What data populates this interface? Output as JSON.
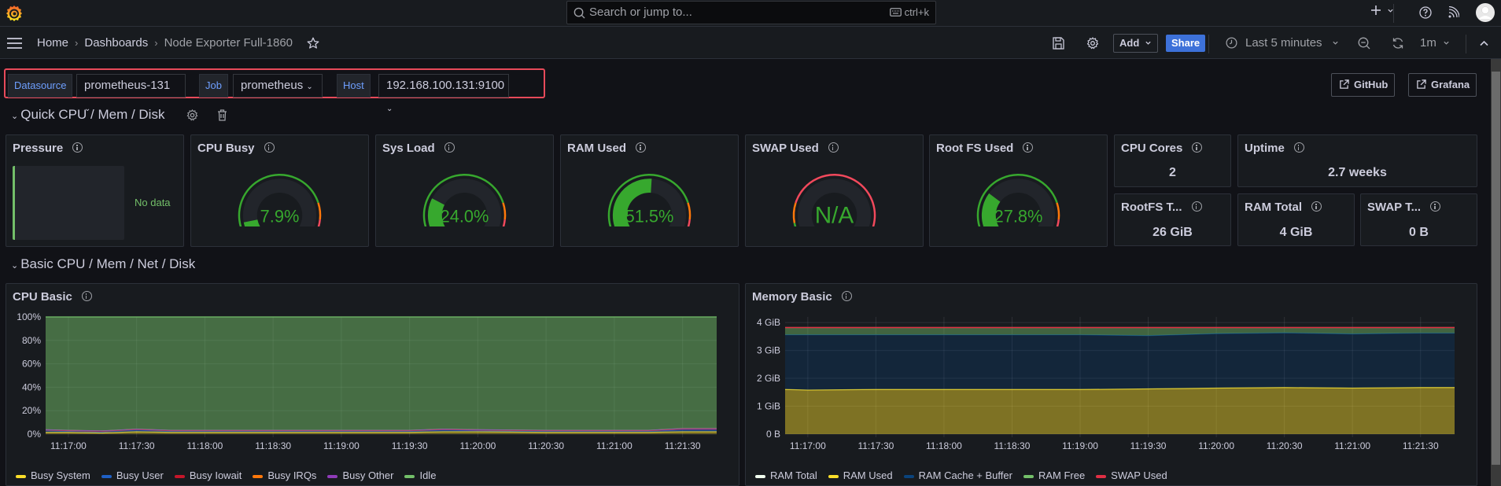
{
  "topbar": {
    "search_placeholder": "Search or jump to...",
    "search_shortcut": "ctrl+k",
    "icons": [
      "grafana-logo-icon",
      "search-icon",
      "keyboard-icon",
      "plus-icon",
      "help-icon",
      "rss-icon",
      "avatar-icon"
    ]
  },
  "navbar": {
    "breadcrumbs": [
      "Home",
      "Dashboards",
      "Node Exporter Full-1860"
    ],
    "add_label": "Add",
    "share_label": "Share",
    "time_range": "Last 5 minutes",
    "refresh_interval": "1m"
  },
  "variables": [
    {
      "label": "Datasource",
      "value": "prometheus-131"
    },
    {
      "label": "Job",
      "value": "prometheus"
    },
    {
      "label": "Host",
      "value": "192.168.100.131:9100"
    }
  ],
  "links": [
    "GitHub",
    "Grafana"
  ],
  "rows": [
    {
      "title": "Quick CPU / Mem / Disk"
    },
    {
      "title": "Basic CPU / Mem / Net / Disk"
    }
  ],
  "panels": {
    "pressure": {
      "title": "Pressure",
      "value": "No data"
    },
    "cpu_busy": {
      "title": "CPU Busy",
      "value": "7.9%",
      "percent": 7.9
    },
    "sys_load": {
      "title": "Sys Load",
      "value": "24.0%",
      "percent": 24.0
    },
    "ram_used": {
      "title": "RAM Used",
      "value": "51.5%",
      "percent": 51.5
    },
    "swap_used": {
      "title": "SWAP Used",
      "value": "N/A",
      "percent": null
    },
    "root_fs_used": {
      "title": "Root FS Used",
      "value": "27.8%",
      "percent": 27.8
    },
    "cpu_cores": {
      "title": "CPU Cores",
      "value": "2"
    },
    "uptime": {
      "title": "Uptime",
      "value": "2.7 weeks"
    },
    "rootfs_total": {
      "title": "RootFS T...",
      "value": "26 GiB"
    },
    "ram_total": {
      "title": "RAM Total",
      "value": "4 GiB"
    },
    "swap_total": {
      "title": "SWAP T...",
      "value": "0 B"
    }
  },
  "colors": {
    "green": "#37a82e",
    "orange": "#ff780a",
    "red": "#f2495c",
    "accent": "#3d71d9"
  },
  "chart_data": [
    {
      "type": "area",
      "title": "CPU Basic",
      "ylim": [
        0,
        100
      ],
      "yticks": [
        "0%",
        "20%",
        "40%",
        "60%",
        "80%",
        "100%"
      ],
      "x": [
        "11:16:50",
        "11:17:00",
        "11:17:15",
        "11:17:30",
        "11:17:45",
        "11:18:00",
        "11:18:30",
        "11:19:00",
        "11:19:30",
        "11:19:45",
        "11:20:00",
        "11:20:30",
        "11:21:00",
        "11:21:15",
        "11:21:30",
        "11:21:45"
      ],
      "xticks": [
        "11:17:00",
        "11:17:30",
        "11:18:00",
        "11:18:30",
        "11:19:00",
        "11:19:30",
        "11:20:00",
        "11:20:30",
        "11:21:00",
        "11:21:30"
      ],
      "stacked": true,
      "series": [
        {
          "name": "Busy System",
          "color": "#fade2a",
          "values": [
            1.5,
            1.5,
            1,
            2,
            1.5,
            1.5,
            1.5,
            1.5,
            1.5,
            2,
            2,
            1.5,
            1.5,
            1.5,
            2,
            2
          ]
        },
        {
          "name": "Busy User",
          "color": "#1f60c4",
          "values": [
            1.5,
            1,
            1,
            1.5,
            1,
            1,
            1,
            1,
            1,
            1.5,
            1,
            1,
            1,
            1,
            1.5,
            1.5
          ]
        },
        {
          "name": "Busy Iowait",
          "color": "#c4162a",
          "values": [
            0.5,
            0.5,
            0.5,
            0.5,
            0.5,
            0.5,
            0.5,
            0.5,
            0.5,
            0.5,
            0.5,
            0.5,
            0.5,
            0.5,
            1,
            1
          ]
        },
        {
          "name": "Busy IRQs",
          "color": "#ff780a",
          "values": [
            0.2,
            0.2,
            0.2,
            0.2,
            0.2,
            0.2,
            0.2,
            0.2,
            0.2,
            0.2,
            0.2,
            0.2,
            0.2,
            0.2,
            0.2,
            0.2
          ]
        },
        {
          "name": "Busy Other",
          "color": "#8f3bb8",
          "values": [
            0.1,
            0.1,
            0.1,
            0.1,
            0.1,
            0.1,
            0.1,
            0.1,
            0.1,
            0.1,
            0.1,
            0.1,
            0.1,
            0.1,
            0.1,
            0.1
          ]
        },
        {
          "name": "Idle",
          "color": "#73bf69",
          "values": [
            96.2,
            96.7,
            97.2,
            95.7,
            96.7,
            96.7,
            96.7,
            96.7,
            96.7,
            95.7,
            96.2,
            96.7,
            96.7,
            96.7,
            95.2,
            95.2
          ]
        }
      ],
      "legend": "bottom"
    },
    {
      "type": "area",
      "title": "Memory Basic",
      "ylim": [
        0,
        4.2
      ],
      "yticks": [
        "0 B",
        "1 GiB",
        "2 GiB",
        "3 GiB",
        "4 GiB"
      ],
      "x": [
        "11:16:50",
        "11:17:00",
        "11:17:30",
        "11:18:00",
        "11:18:30",
        "11:19:00",
        "11:19:30",
        "11:20:00",
        "11:20:30",
        "11:21:00",
        "11:21:30",
        "11:21:45"
      ],
      "xticks": [
        "11:17:00",
        "11:17:30",
        "11:18:00",
        "11:18:30",
        "11:19:00",
        "11:19:30",
        "11:20:00",
        "11:20:30",
        "11:21:00",
        "11:21:30"
      ],
      "series": [
        {
          "name": "RAM Total",
          "color": "#f0fdee",
          "values": [
            3.82,
            3.82,
            3.82,
            3.82,
            3.82,
            3.82,
            3.82,
            3.82,
            3.82,
            3.82,
            3.82,
            3.82
          ]
        },
        {
          "name": "RAM Used",
          "color": "#fade2a",
          "values": [
            1.6,
            1.58,
            1.6,
            1.6,
            1.6,
            1.6,
            1.62,
            1.65,
            1.67,
            1.65,
            1.67,
            1.67
          ]
        },
        {
          "name": "RAM Cache + Buffer",
          "color": "#0a437c",
          "values": [
            1.96,
            1.98,
            1.96,
            1.96,
            1.96,
            1.96,
            1.91,
            1.95,
            1.96,
            1.94,
            1.95,
            1.95
          ]
        },
        {
          "name": "RAM Free",
          "color": "#73bf69",
          "values": [
            0.26,
            0.26,
            0.26,
            0.26,
            0.26,
            0.26,
            0.29,
            0.22,
            0.19,
            0.23,
            0.2,
            0.2
          ]
        },
        {
          "name": "SWAP Used",
          "color": "#e02f44",
          "values": [
            0,
            0,
            0,
            0,
            0,
            0,
            0,
            0,
            0,
            0,
            0,
            0
          ]
        }
      ],
      "legend": "bottom"
    }
  ]
}
